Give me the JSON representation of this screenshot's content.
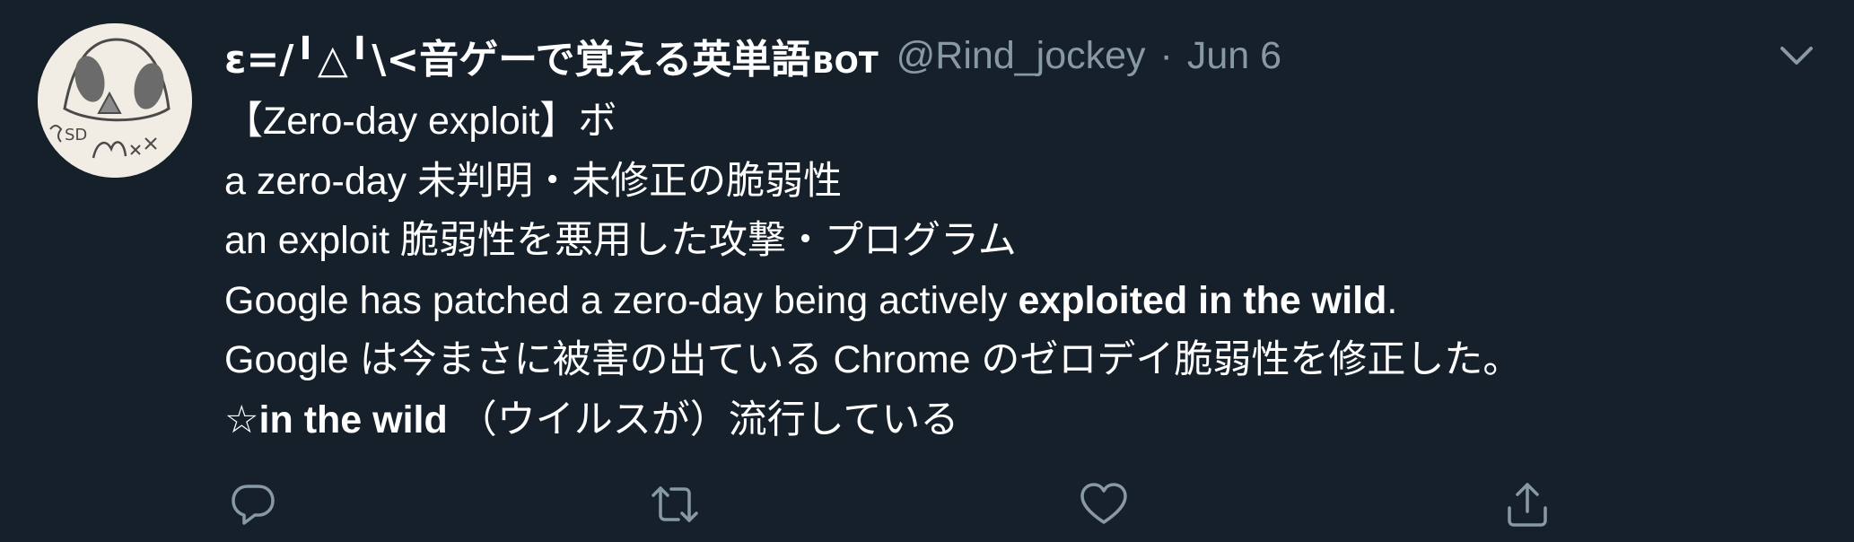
{
  "tweet": {
    "display_name": "ε=/╹△╹\\<音ゲーで覚える英単語",
    "display_name_suffix": "BOT",
    "handle": "@Rind_jockey",
    "separator": "·",
    "date": "Jun 6",
    "lines": [
      "【Zero-day exploit】ボ",
      "a zero-day 未判明・未修正の脆弱性",
      "an exploit 脆弱性を悪用した攻撃・プログラム"
    ],
    "line4": {
      "normal": "Google has patched a zero-day being actively ",
      "bold": "exploited in the wild",
      "tail": "."
    },
    "line5": "Google は今まさに被害の出ている Chrome のゼロデイ脆弱性を修正した。",
    "line6": {
      "bold": "☆in the wild",
      "normal": " （ウイルスが）流行している"
    }
  },
  "icons": {
    "avatar": "avatar-drawing",
    "more": "chevron-down-icon",
    "reply": "reply-icon",
    "retweet": "retweet-icon",
    "like": "heart-icon",
    "share": "share-icon"
  },
  "colors": {
    "background": "#15202b",
    "text": "#ffffff",
    "muted": "#8899a6"
  }
}
